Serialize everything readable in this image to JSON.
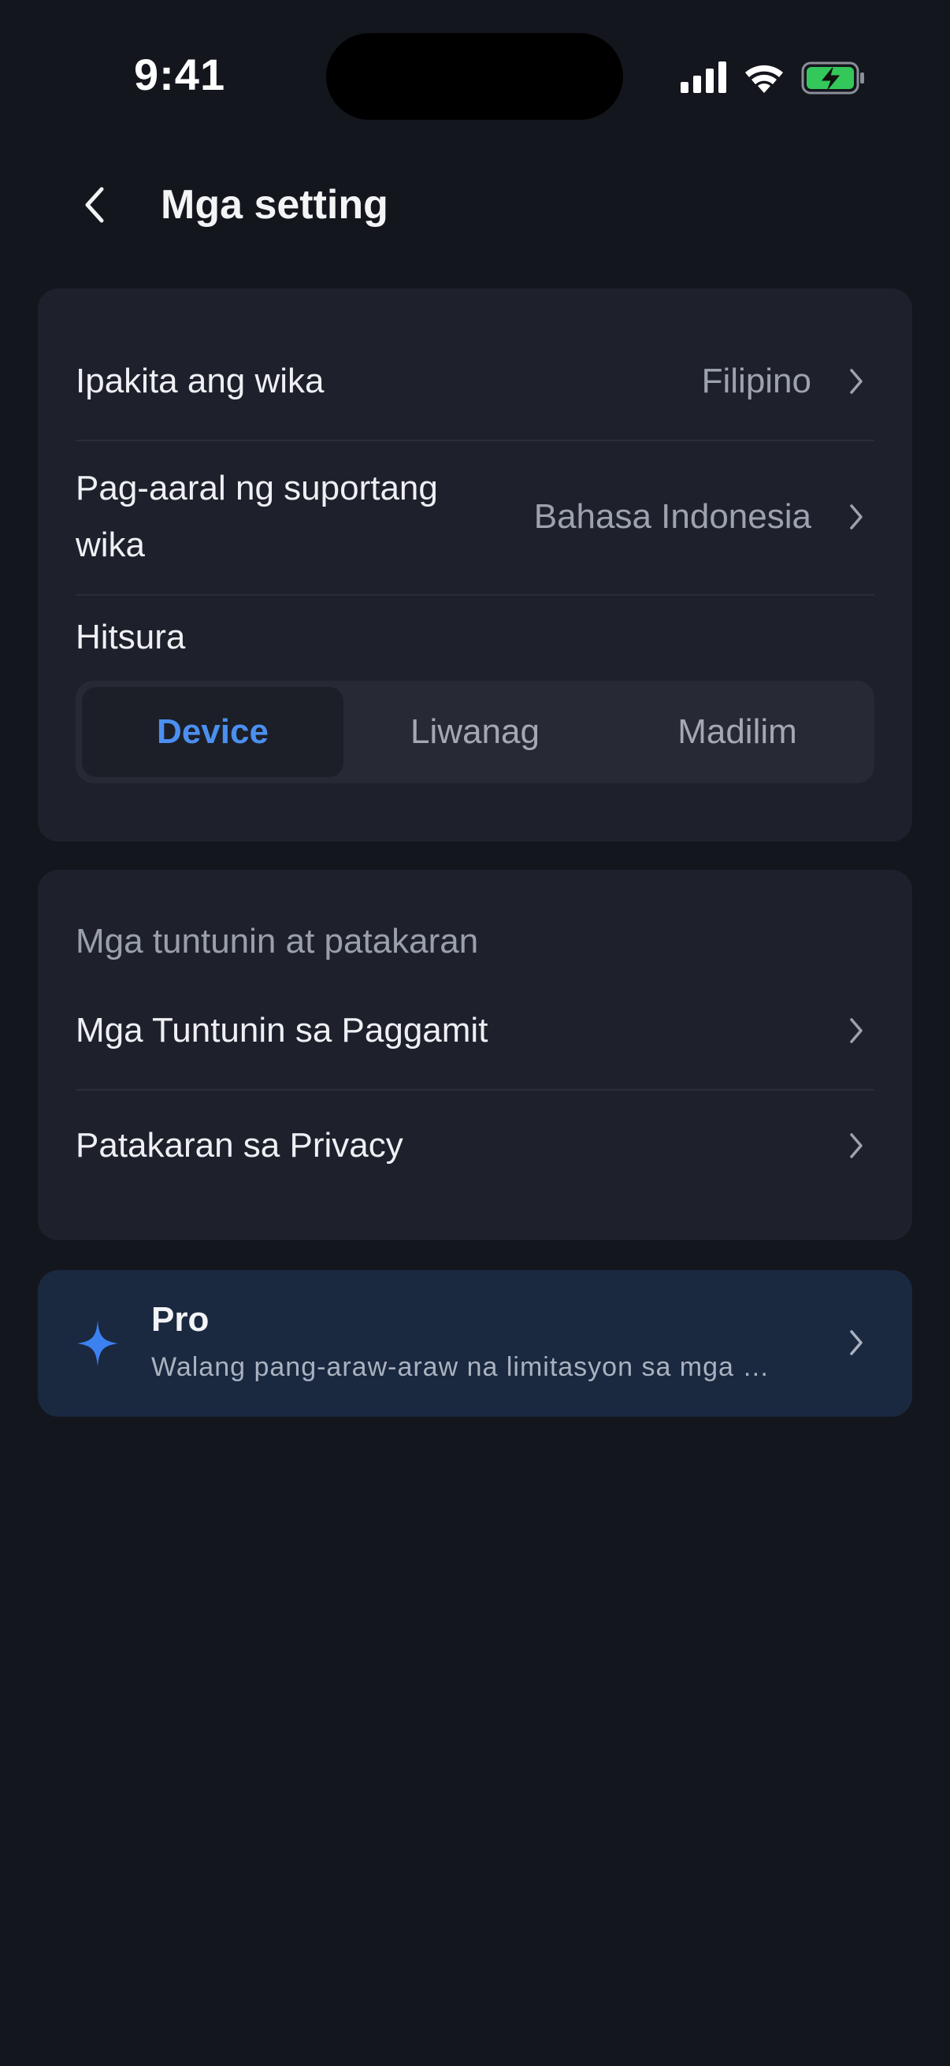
{
  "status_bar": {
    "time": "9:41"
  },
  "header": {
    "title": "Mga setting"
  },
  "settings": {
    "display_language": {
      "label": "Ipakita ang wika",
      "value": "Filipino"
    },
    "learning_language": {
      "label_line1": "Pag-aaral ng suportang",
      "label_line2": "wika",
      "value": "Bahasa Indonesia"
    },
    "appearance": {
      "label": "Hitsura",
      "options": [
        "Device",
        "Liwanag",
        "Madilim"
      ],
      "selected": "Device"
    }
  },
  "policies": {
    "section_label": "Mga tuntunin at patakaran",
    "items": [
      {
        "label": "Mga Tuntunin sa Paggamit"
      },
      {
        "label": "Patakaran sa Privacy"
      }
    ]
  },
  "pro": {
    "title": "Pro",
    "subtitle": "Walang pang-araw-araw na limitasyon sa mga …"
  },
  "colors": {
    "background": "#14161e",
    "card": "#1e212b",
    "accent": "#4b8ff0",
    "pro_card": "#1a2840",
    "battery_green": "#34c759"
  },
  "icons": [
    "back-chevron-icon",
    "chevron-right-icon",
    "sparkle-icon",
    "signal-icon",
    "wifi-icon",
    "battery-charging-icon"
  ]
}
